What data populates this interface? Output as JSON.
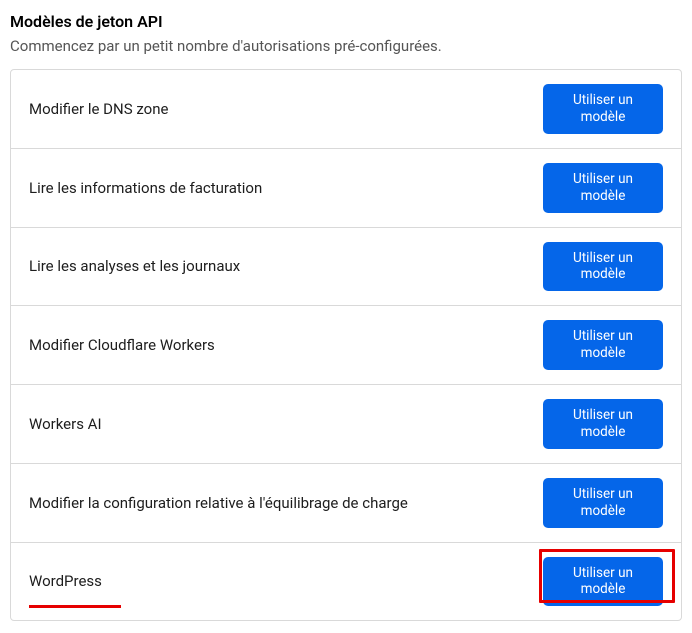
{
  "header": {
    "title": "Modèles de jeton API",
    "subtitle": "Commencez par un petit nombre d'autorisations pré-configurées."
  },
  "button_label_line1": "Utiliser un",
  "button_label_line2": "modèle",
  "templates": [
    {
      "label": "Modifier le DNS zone"
    },
    {
      "label": "Lire les informations de facturation"
    },
    {
      "label": "Lire les analyses et les journaux"
    },
    {
      "label": "Modifier Cloudflare Workers"
    },
    {
      "label": "Workers AI"
    },
    {
      "label": "Modifier la configuration relative à l'équilibrage de charge"
    },
    {
      "label": "WordPress"
    }
  ]
}
